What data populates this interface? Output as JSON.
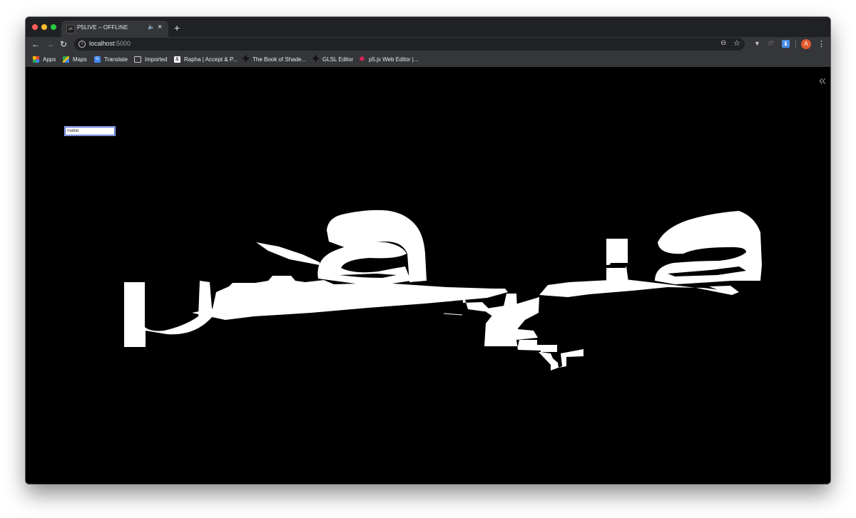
{
  "tab": {
    "favicon_text": "p5",
    "title": "P5LIVE – OFFLINE",
    "audio_glyph": "🔈",
    "close_glyph": "×"
  },
  "newtab_glyph": "+",
  "nav": {
    "back": "←",
    "forward": "→",
    "reload": "↻"
  },
  "address": {
    "host": "localhost",
    "port": ":5000"
  },
  "bookmarks": [
    {
      "icon": "apps-icon",
      "label": "Apps"
    },
    {
      "icon": "maps-icon",
      "label": "Maps"
    },
    {
      "icon": "translate-icon",
      "label": "Translate"
    },
    {
      "icon": "folder-icon",
      "label": "Imported"
    },
    {
      "icon": "rapha-icon",
      "label": "Rapha | Accept & P..."
    },
    {
      "icon": "cross-icon",
      "label": "The Book of Shade..."
    },
    {
      "icon": "cross-icon",
      "label": "GLSL Editor"
    },
    {
      "icon": "p5-star-icon",
      "label": "p5.js Web Editor |..."
    }
  ],
  "profile_initial": "A",
  "sketch": {
    "input_value": "mattie",
    "background_color": "#000000",
    "shape_color": "#ffffff",
    "collapse_glyph": "«"
  },
  "colors": {
    "tabstrip": "#202124",
    "toolbar": "#35363a",
    "close": "#ff5f57",
    "minimize": "#febc2e",
    "maximize": "#28c840",
    "avatar": "#e2582e"
  }
}
